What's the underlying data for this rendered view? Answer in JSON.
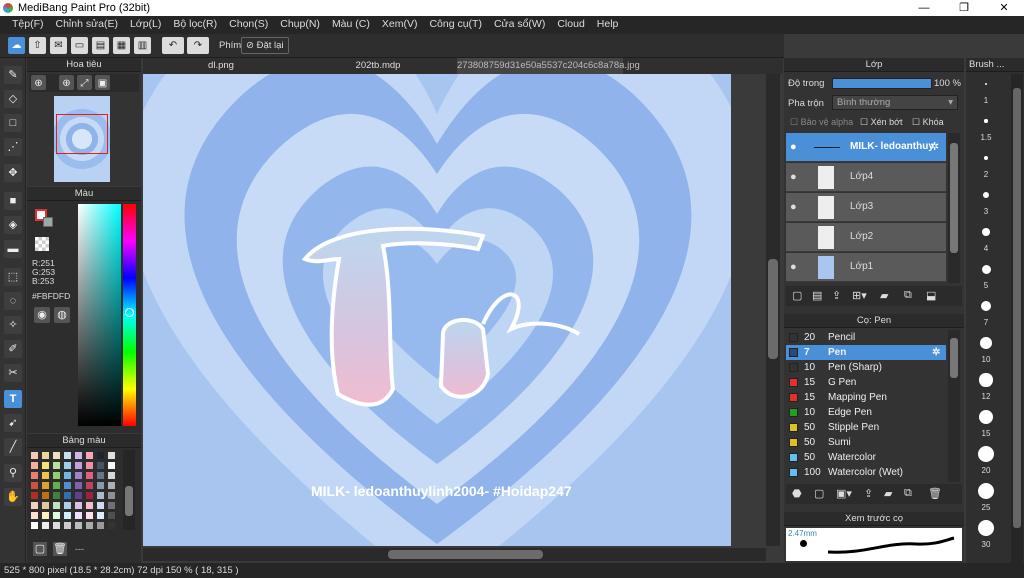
{
  "app": {
    "title": "MediBang Paint Pro (32bit)",
    "min": "—",
    "max": "❐",
    "close": "✕"
  },
  "menu": [
    "Tệp(F)",
    "Chỉnh sửa(E)",
    "Lớp(L)",
    "Bộ lọc(R)",
    "Chọn(S)",
    "Chụp(N)",
    "Màu (C)",
    "Xem(V)",
    "Công cụ(T)",
    "Cửa sổ(W)",
    "Cloud",
    "Help"
  ],
  "toolbar": {
    "phim_label": "Phím",
    "reset_label": "Đặt lại"
  },
  "tabs": [
    "dl.png",
    "202tb.mdp",
    "273808759d31e50a5537c204c6c8a78a.jpg"
  ],
  "navigator": {
    "title": "Hoa tiêu"
  },
  "color": {
    "title": "Màu",
    "r": "R:251",
    "g": "G:253",
    "b": "B:253",
    "hex": "#FBFDFD"
  },
  "palette": {
    "title": "Bảng màu",
    "more": "---"
  },
  "layers": {
    "title": "Lớp",
    "opacity_label": "Độ trong",
    "opacity_value": "100 %",
    "blend_label": "Pha trộn",
    "blend_value": "Bình thường",
    "protect_alpha": "Bảo vệ alpha",
    "clipping": "Xén bớt",
    "lock": "Khóa",
    "items": [
      "MILK- ledoanthuy",
      "Lớp4",
      "Lớp3",
      "Lớp2",
      "Lớp1"
    ]
  },
  "brushes": {
    "title": "Cọ: Pen",
    "items": [
      {
        "size": "20",
        "name": "Pencil",
        "color": "#333333"
      },
      {
        "size": "7",
        "name": "Pen",
        "color": "#2a4a7a"
      },
      {
        "size": "10",
        "name": "Pen (Sharp)",
        "color": "#333333"
      },
      {
        "size": "15",
        "name": "G Pen",
        "color": "#e03030"
      },
      {
        "size": "15",
        "name": "Mapping Pen",
        "color": "#e03030"
      },
      {
        "size": "10",
        "name": "Edge Pen",
        "color": "#20a020"
      },
      {
        "size": "50",
        "name": "Stipple Pen",
        "color": "#e0c020"
      },
      {
        "size": "50",
        "name": "Sumi",
        "color": "#e0c020"
      },
      {
        "size": "50",
        "name": "Watercolor",
        "color": "#60c0f0"
      },
      {
        "size": "100",
        "name": "Watercolor (Wet)",
        "color": "#60c0f0"
      }
    ]
  },
  "preview": {
    "title": "Xem trước cọ",
    "size": "2.47mm"
  },
  "brushsize": {
    "title": "Brush ...",
    "sizes": [
      "1",
      "1.5",
      "2",
      "3",
      "4",
      "5",
      "7",
      "10",
      "12",
      "15",
      "20",
      "25",
      "30"
    ]
  },
  "artwork": {
    "caption": "MILK- ledoanthuylinh2004- #Hoidap247",
    "colors": {
      "bg": "#a9c6f0",
      "ring": "#8db2ea",
      "light": "#c4d8f4"
    }
  },
  "status": {
    "text": "525 * 800 pixel  (18.5 * 28.2cm)  72 dpi  150 %  ( 18, 315 )"
  }
}
